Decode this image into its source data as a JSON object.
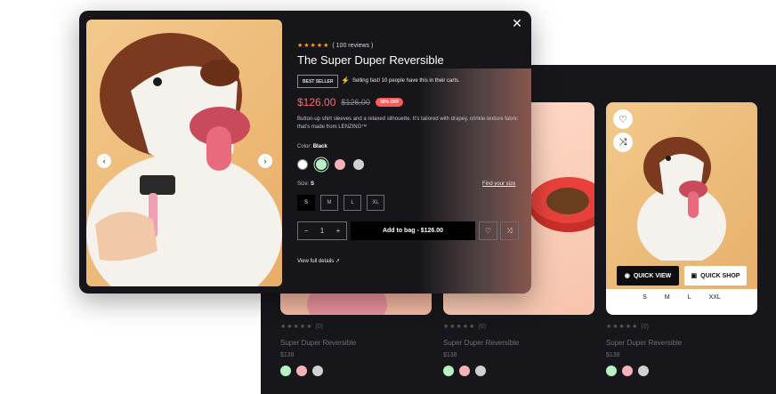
{
  "colors": {
    "accent": "#ff6b6b",
    "modal_bg": "#16151a",
    "grid_bg": "#17161b"
  },
  "modal": {
    "rating_stars": "★★★★★",
    "rating_text": "( 100 reviews )",
    "title": "The Super Duper Reversible",
    "badge": "BEST SELLER",
    "selling_icon": "bolt-icon",
    "selling_text": "Selling fast! 10 people have this in their carts.",
    "price": "$126.00",
    "old_price": "$126.00",
    "discount": "30% OFF",
    "description": "Button-up shirt sleeves and a relaxed silhouette. It’s tailored with drapey, crinkle-texture fabric that’s made from LENZING™",
    "color_label": "Color:",
    "color_value": "Black",
    "colors": [
      "#ffffff",
      "#b8f2c4",
      "#f5b3b8",
      "#cfcfd4"
    ],
    "size_label": "Size:",
    "size_value": "S",
    "find_size": "Find your size",
    "sizes": [
      "S",
      "M",
      "L",
      "XL"
    ],
    "qty": {
      "minus": "−",
      "value": "1",
      "plus": "+"
    },
    "add_to_bag": "Add to bag - $126.00",
    "view_full": "View full details ↗",
    "close": "✕",
    "prev": "‹",
    "next": "›"
  },
  "grid": {
    "quick_view": "QUICK VIEW",
    "quick_shop": "QUICK SHOP",
    "sizes": [
      "S",
      "M",
      "L",
      "XXL"
    ],
    "products": [
      {
        "stars": "★★★★★",
        "count": "(0)",
        "name": "Super Duper Reversible",
        "price": "$138",
        "swatches": [
          "#b8f2c4",
          "#f5b3b8",
          "#cfcfd4"
        ]
      },
      {
        "stars": "★★★★★",
        "count": "(0)",
        "name": "Super Duper Reversible",
        "price": "$138",
        "swatches": [
          "#b8f2c4",
          "#f5b3b8",
          "#cfcfd4"
        ]
      },
      {
        "stars": "★★★★★",
        "count": "(0)",
        "name": "Super Duper Reversible",
        "price": "$138",
        "swatches": [
          "#b8f2c4",
          "#f5b3b8",
          "#cfcfd4"
        ]
      }
    ]
  }
}
